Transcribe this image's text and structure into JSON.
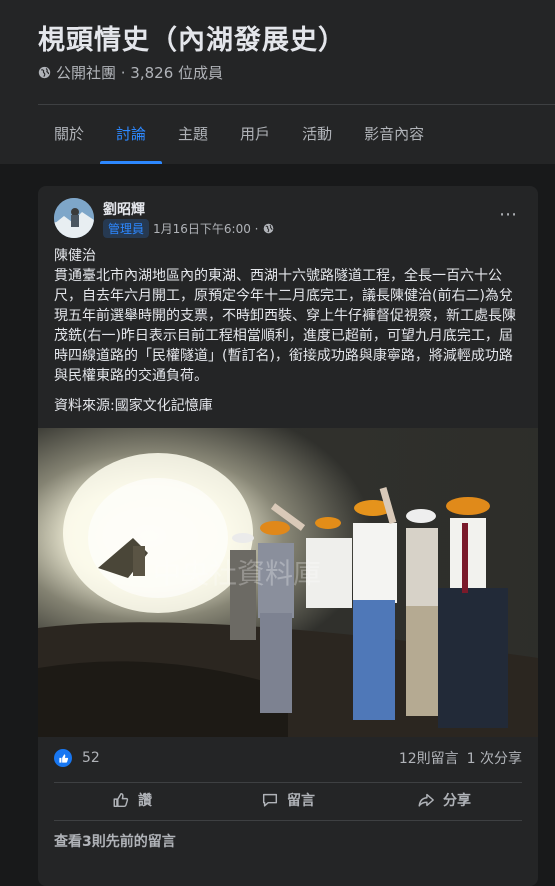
{
  "group": {
    "title": "梘頭情史（內湖發展史）",
    "meta": "公開社團 · 3,826 位成員"
  },
  "tabs": [
    {
      "label": "關於"
    },
    {
      "label": "討論",
      "active": true
    },
    {
      "label": "主題"
    },
    {
      "label": "用戶"
    },
    {
      "label": "活動"
    },
    {
      "label": "影音內容"
    }
  ],
  "post": {
    "author": "劉昭輝",
    "badge": "管理員",
    "timestamp": "1月16日下午6:00 ·",
    "caption_title": "陳健治",
    "body": "貫通臺北市內湖地區內的東湖、西湖十六號路隧道工程，全長一百六十公尺，自去年六月開工，原預定今年十二月底完工，議長陳健治(前右二)為兌現五年前選舉時開的支票，不時卸西裝、穿上牛仔褲督促視察，新工處長陳茂銑(右一)昨日表示目前工程相當順利，進度已超前，可望九月底完工，屆時四線道路的「民權隧道」(暫訂名)，銜接成功路與康寧路，將減輕成功路與民權東路的交通負荷。",
    "source": "資料來源:國家文化記憶庫",
    "photo_watermark": "中央社資料庫",
    "more_icon": "⋯",
    "likes": "52",
    "comments": "12則留言",
    "shares": "1 次分享"
  },
  "actions": {
    "like": "讚",
    "comment": "留言",
    "share": "分享"
  },
  "view_previous": "查看3則先前的留言",
  "colors": {
    "background": "#18191a",
    "surface": "#242526",
    "accent": "#2d88ff",
    "text_primary": "#e4e6eb",
    "text_secondary": "#b0b3b8"
  }
}
